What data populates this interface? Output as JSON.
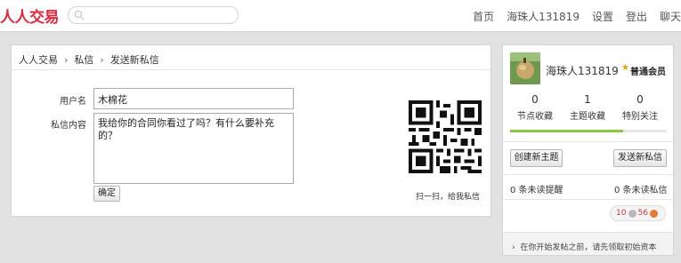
{
  "header": {
    "logo": "人人交易",
    "search_placeholder": "",
    "nav": [
      "首页",
      "海珠人131819",
      "设置",
      "登出",
      "聊天"
    ]
  },
  "breadcrumb": [
    "人人交易",
    "私信",
    "发送新私信"
  ],
  "form": {
    "recipient_label": "用户名",
    "recipient_value": "木棉花",
    "message_label": "私信内容",
    "message_value": "我给你的合同你看过了吗？有什么要补充的？",
    "submit_label": "确定"
  },
  "qr": {
    "caption": "扫一扫，给我私信"
  },
  "profile": {
    "username": "海珠人131819",
    "level": "普通会员",
    "stats": [
      {
        "value": "0",
        "label": "节点收藏"
      },
      {
        "value": "1",
        "label": "主题收藏"
      },
      {
        "value": "0",
        "label": "特别关注"
      }
    ],
    "progress": 0.72,
    "create_topic_label": "创建新主题",
    "send_message_label": "发送新私信",
    "unread_reminders": "0 条未读提醒",
    "unread_messages": "0 条未读私信",
    "coins": {
      "silver": "10",
      "bronze": "56"
    },
    "tip": "在你开始发帖之前，请先领取初始资本"
  },
  "colors": {
    "brand": "#e3273d",
    "progress": "#8dc63f"
  },
  "icons": {
    "search": "search-icon",
    "star": "star-icon",
    "chevron": "chevron-right-icon"
  }
}
